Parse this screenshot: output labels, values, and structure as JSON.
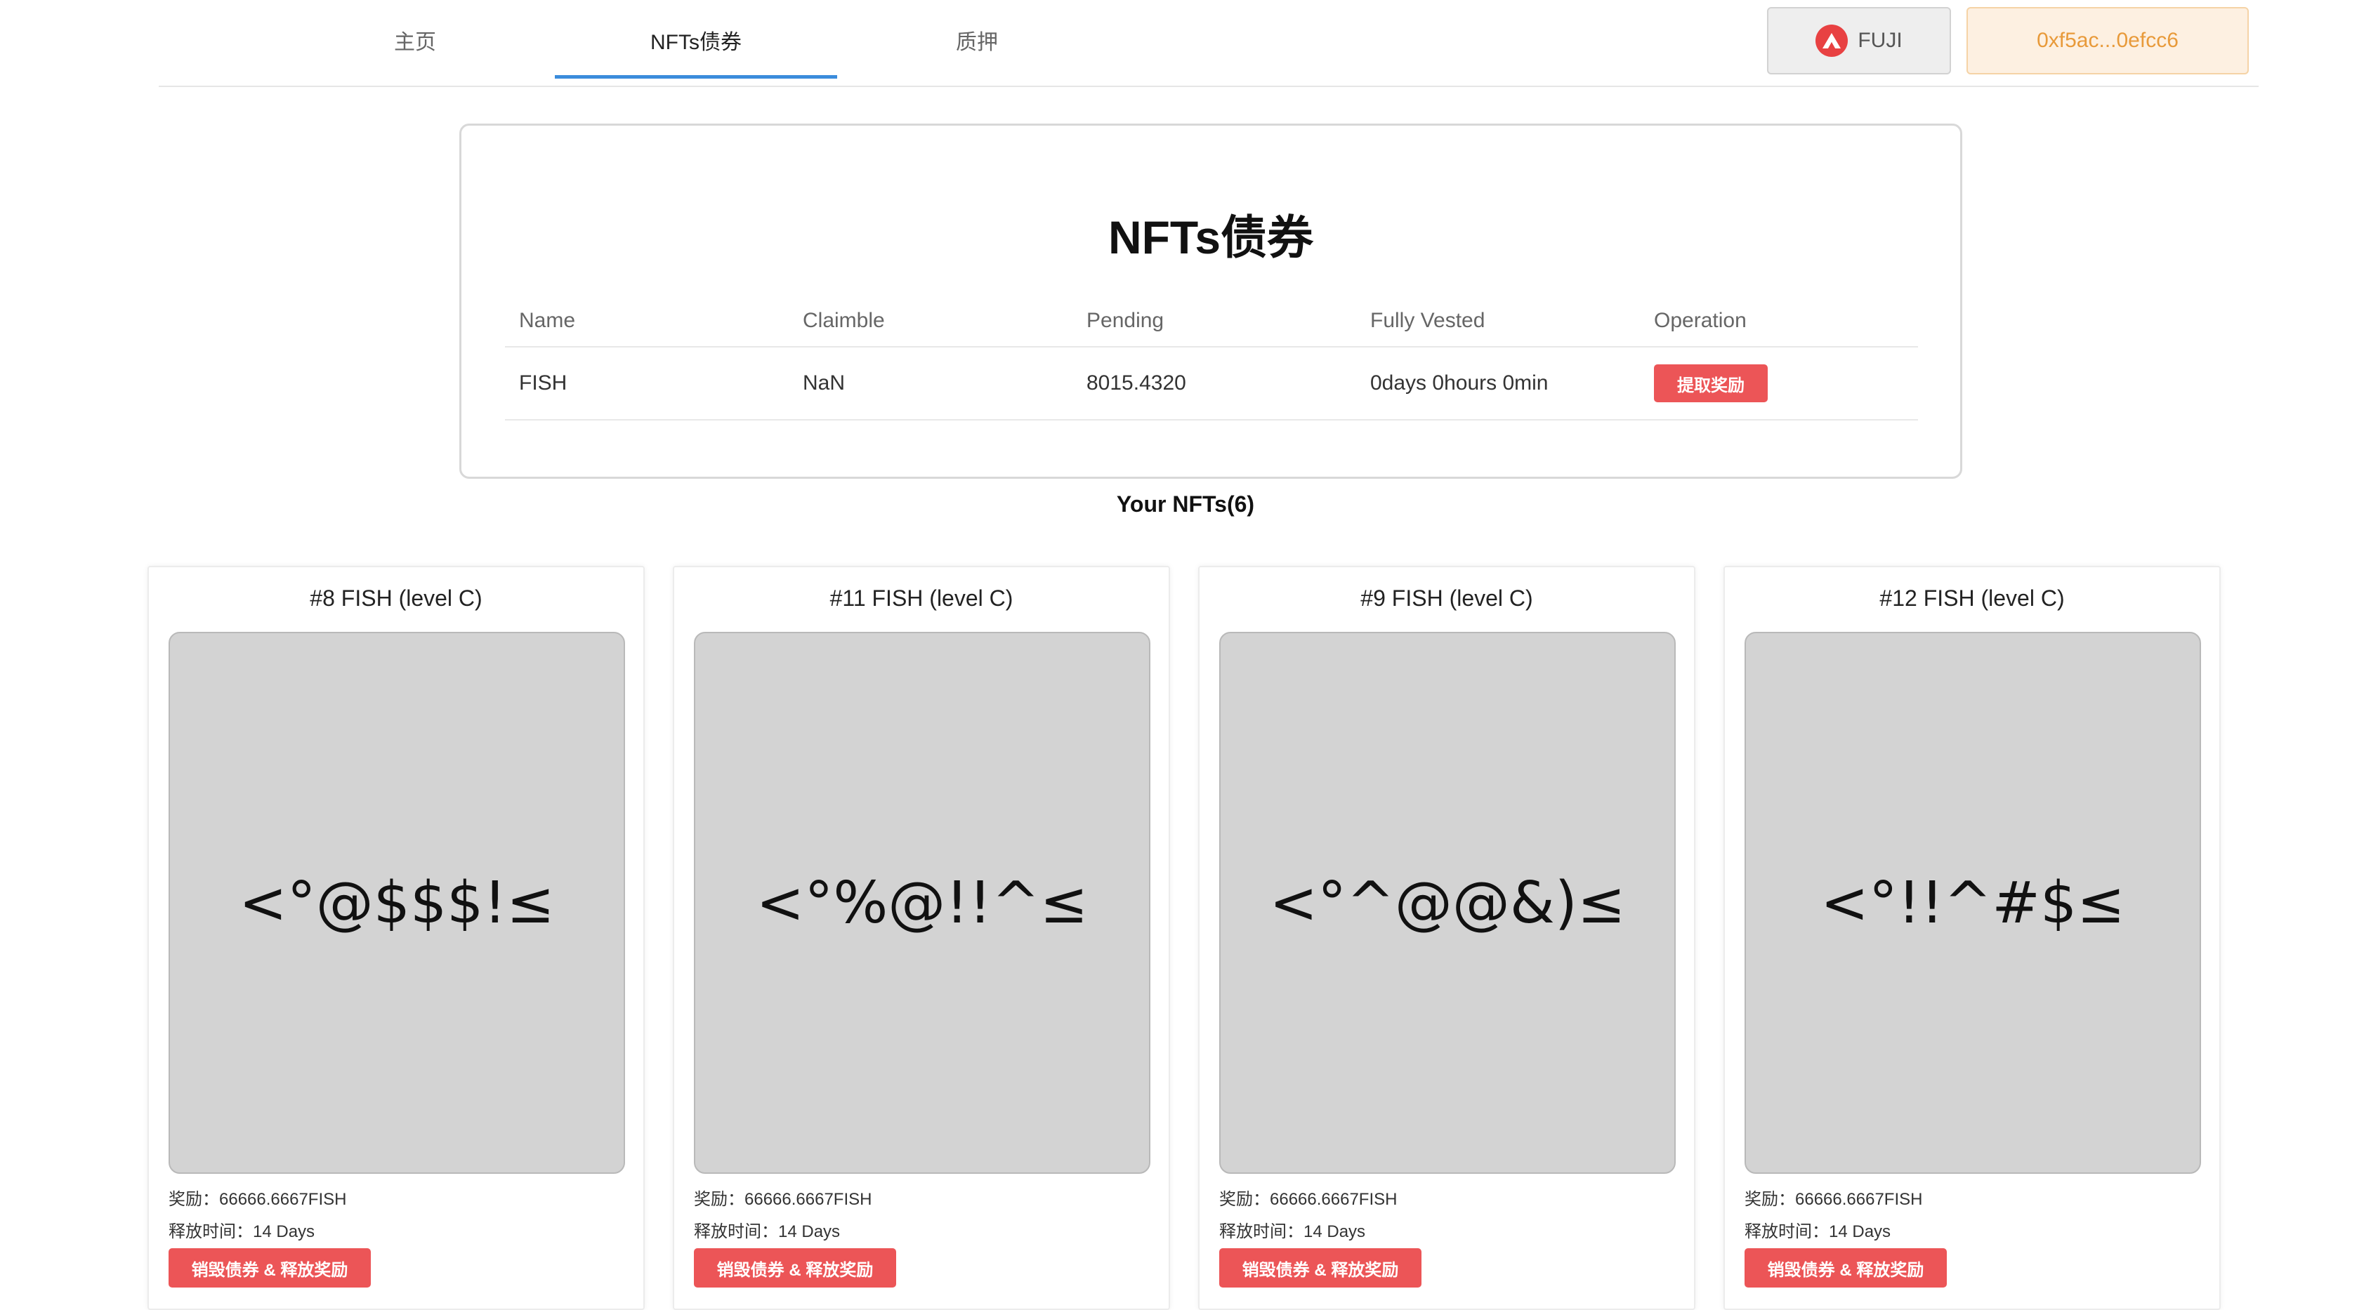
{
  "nav": {
    "tabs": [
      {
        "label": "主页"
      },
      {
        "label": "NFTs债券"
      },
      {
        "label": "质押"
      }
    ],
    "active_tab": "NFTs债券",
    "network_label": "FUJI",
    "wallet_address": "0xf5ac...0efcc6"
  },
  "bond": {
    "title": "NFTs债券",
    "columns": [
      "Name",
      "Claimble",
      "Pending",
      "Fully Vested",
      "Operation"
    ],
    "rows": [
      {
        "name": "FISH",
        "claimble": "NaN",
        "pending": "8015.4320",
        "fully_vested": "0days 0hours 0min",
        "action_label": "提取奖励"
      }
    ]
  },
  "nfts": {
    "heading": "Your NFTs(6)",
    "items": [
      {
        "title": "#8 FISH (level C)",
        "art": "<°@$$$!≤",
        "reward": "奖励：66666.6667FISH",
        "release": "释放时间：14 Days",
        "action_label": "销毁债券 & 释放奖励"
      },
      {
        "title": "#11 FISH (level C)",
        "art": "<°%@!!^≤",
        "reward": "奖励：66666.6667FISH",
        "release": "释放时间：14 Days",
        "action_label": "销毁债券 & 释放奖励"
      },
      {
        "title": "#9 FISH (level C)",
        "art": "<°^@@&)≤",
        "reward": "奖励：66666.6667FISH",
        "release": "释放时间：14 Days",
        "action_label": "销毁债券 & 释放奖励"
      },
      {
        "title": "#12 FISH (level C)",
        "art": "<°!!^#$≤",
        "reward": "奖励：66666.6667FISH",
        "release": "释放时间：14 Days",
        "action_label": "销毁债券 & 释放奖励"
      }
    ]
  },
  "colors": {
    "accent_blue": "#3b8cdc",
    "danger_red": "#ec5557",
    "avax_red": "#e84142",
    "wallet_orange": "#e89a3a"
  }
}
